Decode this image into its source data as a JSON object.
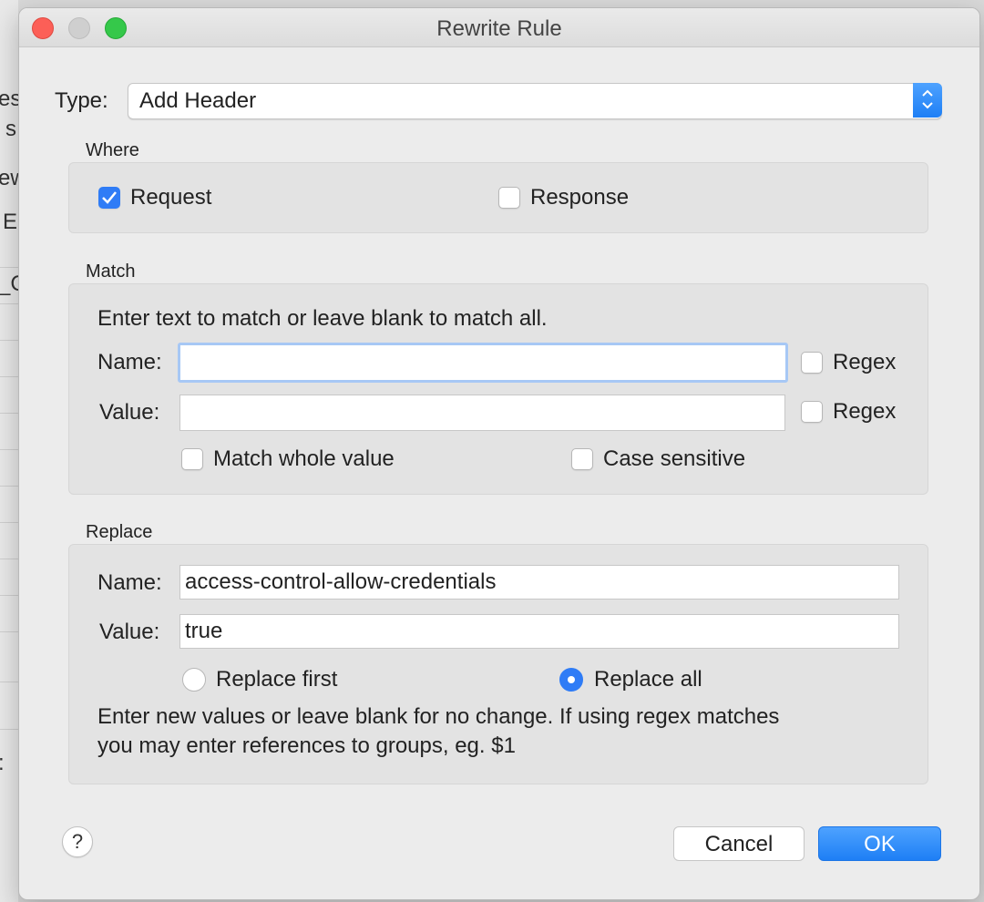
{
  "background_app": {
    "fragments": [
      "es",
      "s t",
      "ew",
      "E",
      "_C",
      ":"
    ]
  },
  "dialog": {
    "title": "Rewrite Rule",
    "type_label": "Type:",
    "type_value": "Add Header",
    "where": {
      "title": "Where",
      "request_label": "Request",
      "request_checked": true,
      "response_label": "Response",
      "response_checked": false
    },
    "match": {
      "title": "Match",
      "hint": "Enter text to match or leave blank to match all.",
      "name_label": "Name:",
      "name_value": "",
      "value_label": "Value:",
      "value_value": "",
      "regex_label": "Regex",
      "match_whole_label": "Match whole value",
      "case_sensitive_label": "Case sensitive"
    },
    "replace": {
      "title": "Replace",
      "name_label": "Name:",
      "name_value": "access-control-allow-credentials",
      "value_label": "Value:",
      "value_value": "true",
      "replace_first_label": "Replace first",
      "replace_all_label": "Replace all",
      "selected": "Replace all",
      "hint_line1": "Enter new values or leave blank for no change. If using regex matches",
      "hint_line2": "you may enter references to groups, eg. $1"
    },
    "help_label": "?",
    "cancel_label": "Cancel",
    "ok_label": "OK"
  },
  "colors": {
    "accent": "#2f7cf6",
    "close": "#fc5f57",
    "maximize": "#35c84a"
  }
}
